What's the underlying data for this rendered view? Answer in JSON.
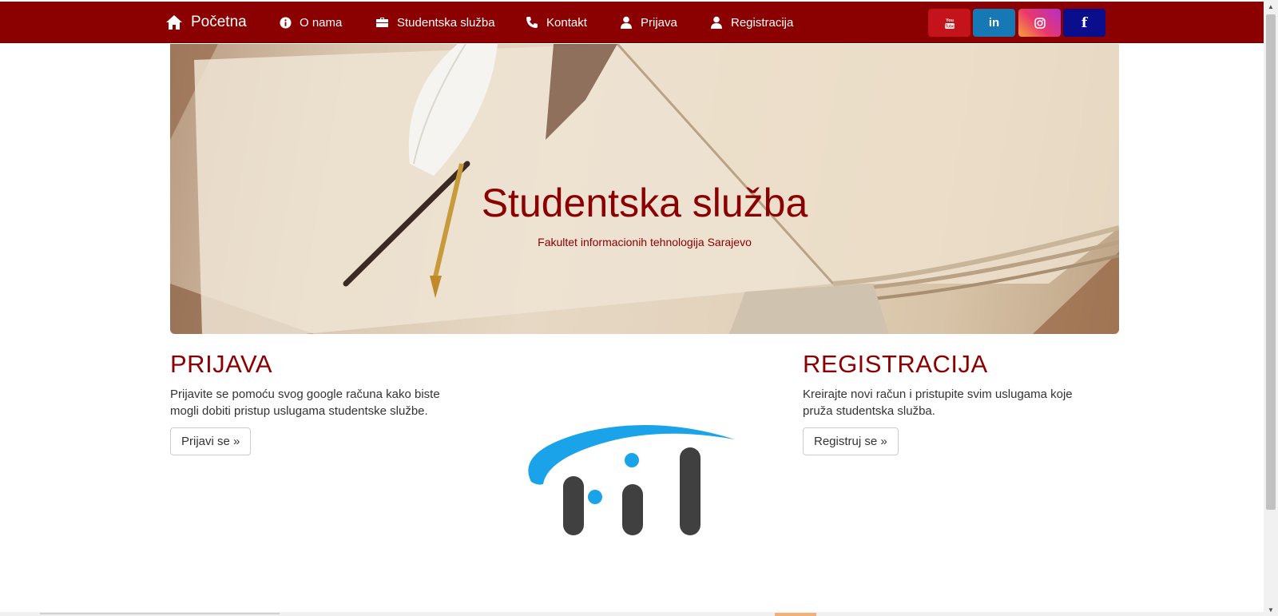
{
  "nav": {
    "brand": "Početna",
    "items": [
      {
        "label": "O nama",
        "icon": "info-circle-icon"
      },
      {
        "label": "Studentska služba",
        "icon": "briefcase-icon"
      },
      {
        "label": "Kontakt",
        "icon": "phone-icon"
      },
      {
        "label": "Prijava",
        "icon": "user-icon"
      },
      {
        "label": "Registracija",
        "icon": "user-icon"
      }
    ],
    "social": [
      {
        "name": "youtube",
        "glyph": "You Tube"
      },
      {
        "name": "linkedin",
        "glyph": "in"
      },
      {
        "name": "instagram",
        "glyph": ""
      },
      {
        "name": "facebook",
        "glyph": "f"
      }
    ]
  },
  "hero": {
    "title": "Studentska služba",
    "subtitle": "Fakultet informacionih tehnologija Sarajevo"
  },
  "prijava": {
    "title": "PRIJAVA",
    "text": "Prijavite se pomoću svog google računa kako biste mogli dobiti pristup uslugama studentske službe.",
    "button": "Prijavi se »"
  },
  "registracija": {
    "title": "REGISTRACIJA",
    "text": "Kreirajte novi račun i pristupite svim uslugama koje pruža studentska služba.",
    "button": "Registruj se »"
  },
  "colors": {
    "nav_bg": "#8b0000",
    "accent": "#8b0000",
    "logo_blue": "#1aa3e8",
    "logo_dark": "#404040"
  }
}
